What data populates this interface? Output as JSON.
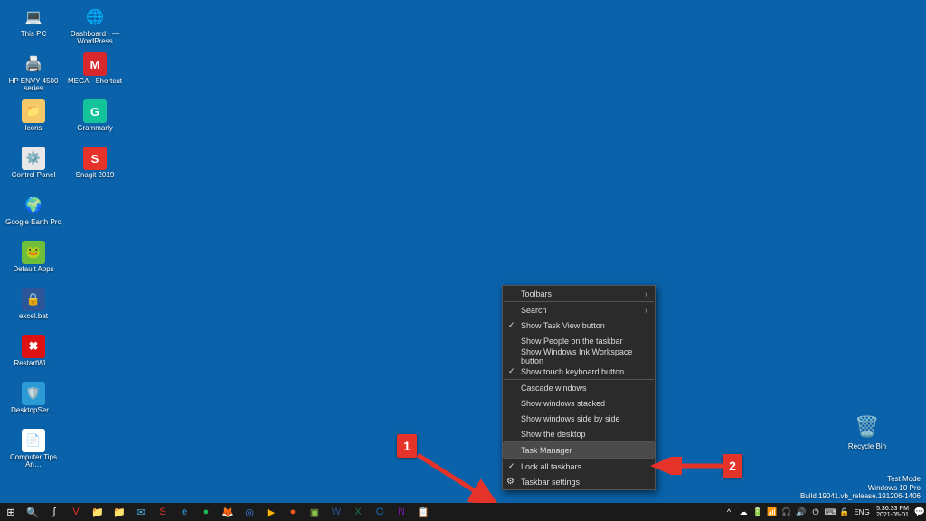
{
  "desktop_icons_col1": [
    {
      "label": "This PC",
      "g": "💻",
      "bg": ""
    },
    {
      "label": "HP ENVY 4500 series",
      "g": "🖨️",
      "bg": ""
    },
    {
      "label": "Icons",
      "g": "📁",
      "bg": "#f5c869"
    },
    {
      "label": "Control Panel",
      "g": "⚙️",
      "bg": "#e7e7e7"
    },
    {
      "label": "Google Earth Pro",
      "g": "🌍",
      "bg": ""
    },
    {
      "label": "Default Apps",
      "g": "🐸",
      "bg": "#6fbf3a"
    },
    {
      "label": "excel.bat",
      "g": "🔒",
      "bg": "#2b579a"
    },
    {
      "label": "RestartWi…",
      "g": "✖",
      "bg": "#d11"
    },
    {
      "label": "DesktopSer…",
      "g": "🛡️",
      "bg": "#2b9bd6"
    },
    {
      "label": "Computer Tips An…",
      "g": "📄",
      "bg": "#ffffff"
    }
  ],
  "desktop_icons_col2": [
    {
      "label": "Dashboard ‹ — WordPress",
      "g": "🌐",
      "bg": ""
    },
    {
      "label": "MEGA - Shortcut",
      "g": "M",
      "bg": "#d9272e"
    },
    {
      "label": "Grammarly",
      "g": "G",
      "bg": "#15c39a"
    },
    {
      "label": "Snagit 2019",
      "g": "S",
      "bg": "#e5332a"
    }
  ],
  "recycle_bin": {
    "label": "Recycle Bin",
    "g": "🗑️"
  },
  "watermark": {
    "l1": "Test Mode",
    "l2": "Windows 10 Pro",
    "l3": "Build 19041.vb_release.191206-1406"
  },
  "context_menu": [
    {
      "label": "Toolbars",
      "submenu": true
    },
    {
      "sep": true
    },
    {
      "label": "Search",
      "submenu": true
    },
    {
      "label": "Show Task View button",
      "check": true
    },
    {
      "label": "Show People on the taskbar"
    },
    {
      "label": "Show Windows Ink Workspace button"
    },
    {
      "label": "Show touch keyboard button",
      "check": true
    },
    {
      "sep": true
    },
    {
      "label": "Cascade windows"
    },
    {
      "label": "Show windows stacked"
    },
    {
      "label": "Show windows side by side"
    },
    {
      "label": "Show the desktop"
    },
    {
      "sep": true
    },
    {
      "label": "Task Manager",
      "hover": true
    },
    {
      "sep": true
    },
    {
      "label": "Lock all taskbars",
      "check": true
    },
    {
      "label": "Taskbar settings",
      "gear": true
    }
  ],
  "taskbar": {
    "start": "⊞",
    "search": "🔍",
    "pins": [
      {
        "g": "∫",
        "c": "#fff"
      },
      {
        "g": "V",
        "c": "#e5332a"
      },
      {
        "g": "📁",
        "c": "#f5c869"
      },
      {
        "g": "📁",
        "c": "#f5c869"
      },
      {
        "g": "✉",
        "c": "#57a7dd"
      },
      {
        "g": "S",
        "c": "#e5332a"
      },
      {
        "g": "e",
        "c": "#2b9bd6"
      },
      {
        "g": "●",
        "c": "#1db954"
      },
      {
        "g": "🦊",
        "c": "#ff7139"
      },
      {
        "g": "◎",
        "c": "#4285f4"
      },
      {
        "g": "▶",
        "c": "#ffb400"
      },
      {
        "g": "●",
        "c": "#ff5722"
      },
      {
        "g": "▣",
        "c": "#8bc34a"
      },
      {
        "g": "W",
        "c": "#2b579a"
      },
      {
        "g": "X",
        "c": "#217346"
      },
      {
        "g": "O",
        "c": "#0f6cbd"
      },
      {
        "g": "N",
        "c": "#7719aa"
      },
      {
        "g": "📋",
        "c": "#ccc"
      }
    ]
  },
  "tray": {
    "chevron": "^",
    "icons": [
      "☁",
      "🔋",
      "📶",
      "🎧",
      "🔊",
      "⏻",
      "⌨",
      "🔒"
    ],
    "lang": "ENG",
    "time": "5:36:33 PM",
    "date": "2021-05-01",
    "notif": "💬"
  },
  "callouts": {
    "c1": "1",
    "c2": "2"
  }
}
